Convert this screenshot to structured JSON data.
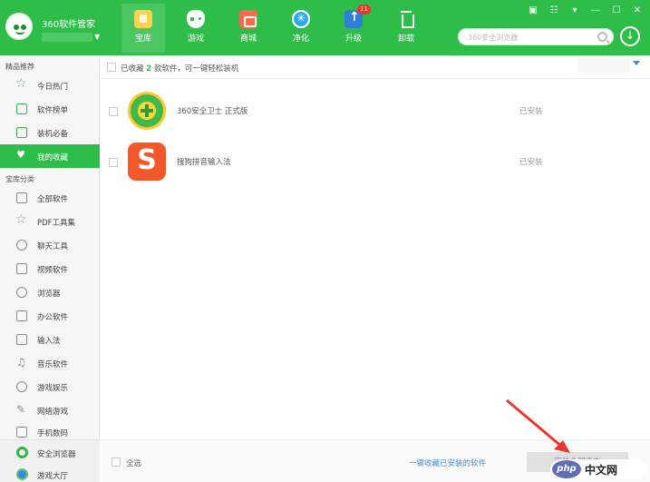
{
  "header": {
    "app_title": "360软件管家",
    "nav": [
      {
        "label": "宝库",
        "icon": "store-icon"
      },
      {
        "label": "游戏",
        "icon": "gamepad-icon"
      },
      {
        "label": "商城",
        "icon": "shopping-bag-icon"
      },
      {
        "label": "净化",
        "icon": "purify-icon"
      },
      {
        "label": "升级",
        "icon": "upgrade-icon",
        "badge": "11"
      },
      {
        "label": "卸载",
        "icon": "trash-icon"
      }
    ],
    "active_nav": "宝库",
    "search": {
      "placeholder": "360安全浏览器",
      "value": ""
    },
    "window_controls": [
      "skin-icon",
      "menu-icon",
      "dropdown-icon",
      "minimize-icon",
      "maximize-icon",
      "close-icon"
    ]
  },
  "sidebar": {
    "section1_title": "精品推荐",
    "section1_items": [
      {
        "label": "今日热门",
        "icon": "star-icon"
      },
      {
        "label": "软件榜单",
        "icon": "list-icon"
      },
      {
        "label": "装机必备",
        "icon": "monitor-icon"
      },
      {
        "label": "我的收藏",
        "icon": "heart-icon",
        "active": true
      }
    ],
    "section2_title": "宝库分类",
    "section2_items": [
      {
        "label": "全部软件",
        "icon": "grid-icon"
      },
      {
        "label": "PDF工具集",
        "icon": "star-outline-icon"
      },
      {
        "label": "聊天工具",
        "icon": "chat-icon"
      },
      {
        "label": "视频软件",
        "icon": "video-icon"
      },
      {
        "label": "浏览器",
        "icon": "browser-icon"
      },
      {
        "label": "办公软件",
        "icon": "office-icon"
      },
      {
        "label": "输入法",
        "icon": "keyboard-icon"
      },
      {
        "label": "音乐软件",
        "icon": "music-icon"
      },
      {
        "label": "游戏娱乐",
        "icon": "gamepad-icon"
      },
      {
        "label": "网络游戏",
        "icon": "pen-icon"
      },
      {
        "label": "手机数码",
        "icon": "phone-icon"
      }
    ],
    "bottom_items": [
      {
        "label": "安全浏览器",
        "icon": "browser-e-icon"
      },
      {
        "label": "游戏大厅",
        "icon": "game-hall-icon"
      }
    ]
  },
  "main": {
    "summary_prefix": "已收藏",
    "summary_count": "2",
    "summary_suffix": "款软件，可一键轻松装机",
    "apps": [
      {
        "name": "360安全卫士 正式版",
        "status": "已安装",
        "icon": "360-safe-icon"
      },
      {
        "name": "搜狗拼音输入法",
        "status": "已安装",
        "icon": "sogou-icon",
        "icon_glyph": "S"
      }
    ],
    "footer": {
      "select_all": "全选",
      "remove_link": "一键收藏已安装的软件",
      "install_button": "安装全部选中"
    }
  },
  "watermark": {
    "logo": "php",
    "text": "中文网"
  }
}
